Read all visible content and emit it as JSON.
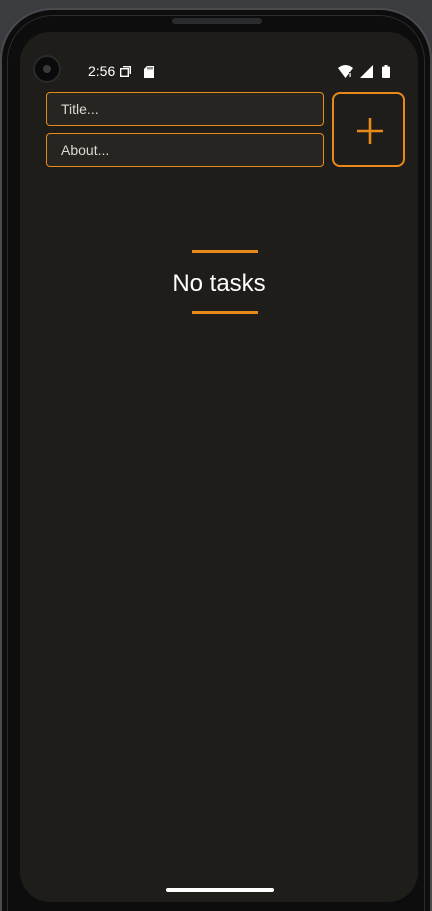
{
  "status_bar": {
    "time": "2:56",
    "icons": [
      "copy-icon",
      "sd-card-icon",
      "wifi-icon",
      "signal-icon",
      "battery-icon"
    ]
  },
  "form": {
    "title_placeholder": "Title...",
    "title_value": "",
    "about_placeholder": "About...",
    "about_value": ""
  },
  "add_button": {
    "icon": "plus-icon"
  },
  "empty_state": {
    "text": "No tasks"
  },
  "colors": {
    "accent": "#e8891c",
    "background": "#1f1d1a",
    "text": "#ffffff"
  }
}
